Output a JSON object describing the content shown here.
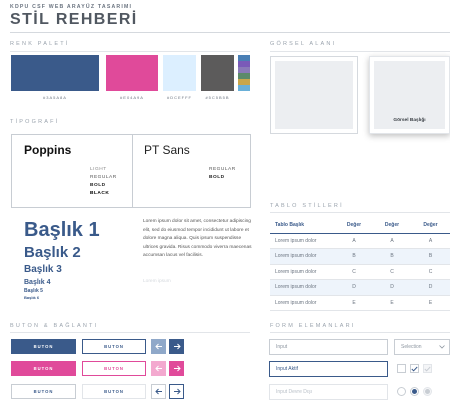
{
  "header": {
    "supertitle": "KDPU CSF WEB ARAYÜZ TASARIMI",
    "title": "STİL REHBERİ"
  },
  "colors": {
    "section_title": "RENK PALETİ",
    "swatches": [
      {
        "hex": "#3A5A8A",
        "label": "#3A5A8A"
      },
      {
        "hex": "#E04A9A",
        "label": "#E04A9A"
      },
      {
        "hex": "#DCEFFF",
        "label": "#DCEFFF"
      },
      {
        "hex": "#5C5B5B",
        "label": "#5C5B5B"
      }
    ],
    "strip": [
      "#4a7fb5",
      "#e04a9a",
      "#8a7ab8",
      "#5c8a6a",
      "#c9a64a",
      "#6ab0d8"
    ]
  },
  "visual": {
    "section_title": "GÖRSEL ALANI",
    "card_caption": "Görsel Başlığı"
  },
  "typography": {
    "section_title": "TİPOGRAFİ",
    "font1": {
      "name": "Poppins",
      "weights": [
        "LIGHT",
        "REGULAR",
        "BOLD",
        "BLACK"
      ]
    },
    "font2": {
      "name": "PT Sans",
      "weights": [
        "REGULAR",
        "BOLD"
      ]
    },
    "headings": [
      "Başlık 1",
      "Başlık 2",
      "Başlık 3",
      "Başlık 4",
      "Başlık 5",
      "Başlık 6"
    ],
    "paragraph": "Lorem ipsum dolor sit amet, consectetur adipiscing elit, sed do eiusmod tempor incididunt ut labore et dolore magna aliqua. Quis ipsum suspendisse ultrices gravida. Risus commodo viverra maecenas accumsan lacus vel facilisis.",
    "faded": "Lorem ipsum"
  },
  "table": {
    "section_title": "TABLO STİLLERİ",
    "headers": [
      "Tablo Başlık",
      "Değer",
      "Değer",
      "Değer"
    ],
    "rows": [
      [
        "Lorem ipsum dolor",
        "A",
        "A",
        "A"
      ],
      [
        "Lorem ipsum dolor",
        "B",
        "B",
        "B"
      ],
      [
        "Lorem ipsum dolor",
        "C",
        "C",
        "C"
      ],
      [
        "Lorem ipsum dolor",
        "D",
        "D",
        "D"
      ],
      [
        "Lorem ipsum dolor",
        "E",
        "E",
        "E"
      ]
    ]
  },
  "buttons": {
    "section_title": "BUTON & BAĞLANTI",
    "label": "BUTON"
  },
  "forms": {
    "section_title": "FORM ELEMANLARI",
    "input_placeholder": "Input",
    "select_value": "Selection",
    "input_active": "Input Aktif",
    "input_disabled": "Input Devre Dışı"
  }
}
